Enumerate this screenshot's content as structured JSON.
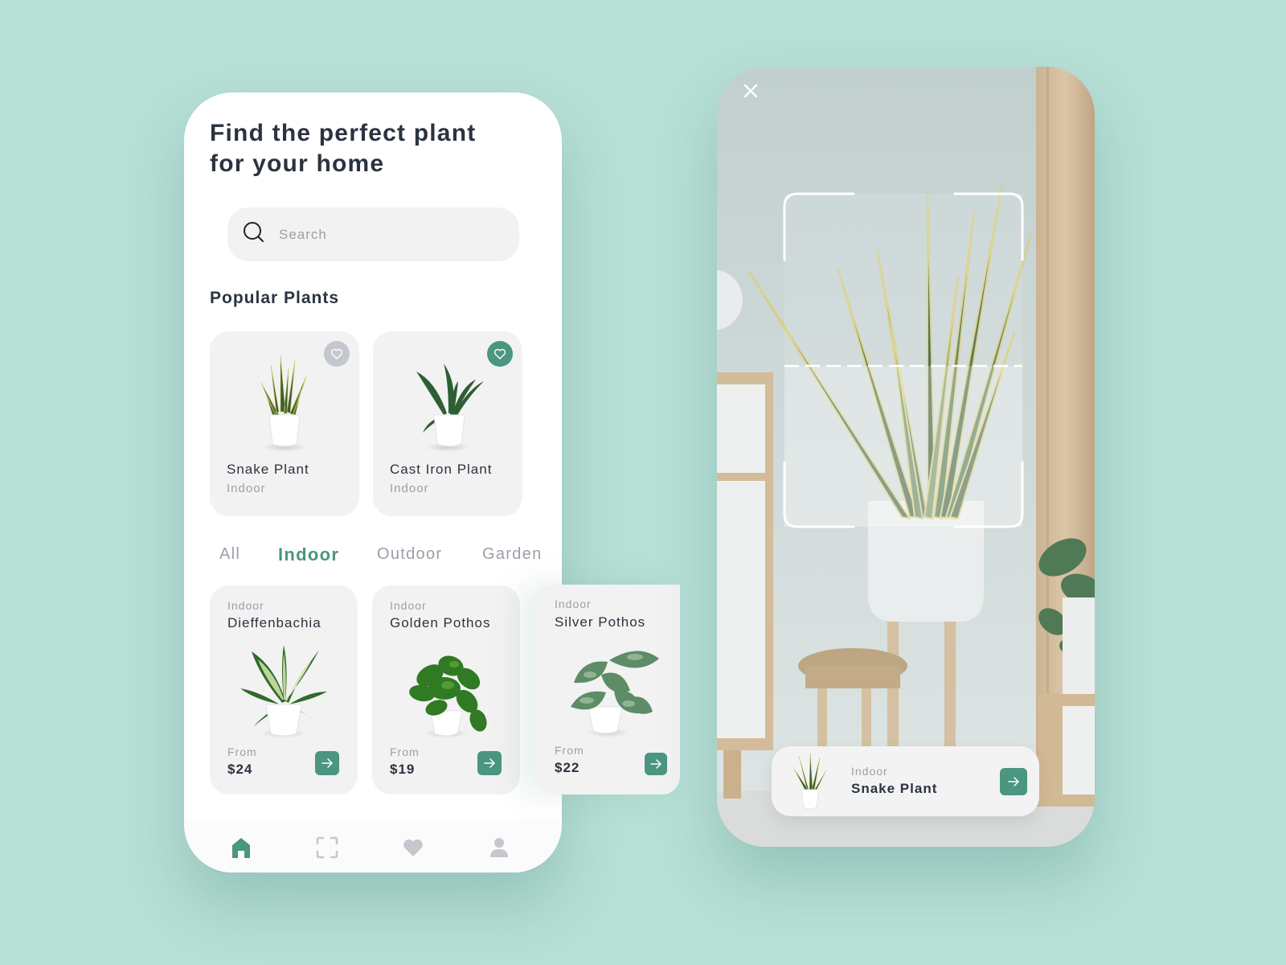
{
  "colors": {
    "background": "#b6dfd6",
    "accent": "#4a9680",
    "text_primary": "#2b3340",
    "text_muted": "#9aa0a8",
    "card_bg": "#f2f2f2",
    "fav_inactive": "#c5c7cf"
  },
  "browse": {
    "headline": "Find the perfect plant for your home",
    "search": {
      "placeholder": "Search",
      "value": "",
      "icon": "search-icon"
    },
    "popular": {
      "title": "Popular Plants",
      "items": [
        {
          "name": "Snake Plant",
          "category": "Indoor",
          "favorited": false
        },
        {
          "name": "Cast Iron Plant",
          "category": "Indoor",
          "favorited": true
        }
      ]
    },
    "tabs": [
      {
        "label": "All",
        "active": false
      },
      {
        "label": "Indoor",
        "active": true
      },
      {
        "label": "Outdoor",
        "active": false
      },
      {
        "label": "Garden",
        "active": false
      }
    ],
    "products": [
      {
        "category": "Indoor",
        "name": "Dieffenbachia",
        "from_label": "From",
        "price": "$24"
      },
      {
        "category": "Indoor",
        "name": "Golden Pothos",
        "from_label": "From",
        "price": "$19"
      },
      {
        "category": "Indoor",
        "name": "Silver Pothos",
        "from_label": "From",
        "price": "$22"
      }
    ],
    "bottom_nav": [
      {
        "icon": "home-icon",
        "active": true
      },
      {
        "icon": "scan-icon",
        "active": false
      },
      {
        "icon": "heart-icon",
        "active": false
      },
      {
        "icon": "user-icon",
        "active": false
      }
    ]
  },
  "scanner": {
    "close_icon": "close-icon",
    "result": {
      "category": "Indoor",
      "name": "Snake Plant"
    }
  }
}
